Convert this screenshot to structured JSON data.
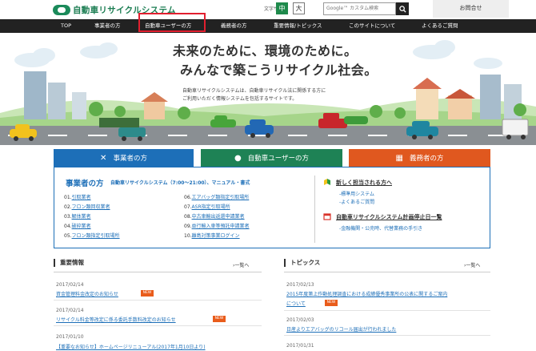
{
  "header": {
    "logo_text": "自動車リサイクルシステム",
    "font_size_label": "文字サイズ",
    "font_size_mid": "中",
    "font_size_large": "大",
    "search_placeholder": "Google™ カスタム検索",
    "inquiry": "お問合せ"
  },
  "nav": [
    "TOP",
    "事業者の方",
    "自動車ユーザーの方",
    "義務者の方",
    "重要情報/トピックス",
    "このサイトについて",
    "よくあるご質問"
  ],
  "hero": {
    "title_1": "未来のために、環境のために。",
    "title_2": "みんなで築こうリサイクル社会。",
    "desc_1": "自動車リサイクルシステムは、自動車リサイクル法に関係する方に",
    "desc_2": "ご利用いただく情報システムを包括するサイトです。"
  },
  "tabs": {
    "business": "事業者の方",
    "users": "自動車ユーザーの方",
    "obligors": "義務者の方"
  },
  "panel": {
    "heading": "事業者の方",
    "subheading": "自動車リサイクルシステム（7:00〜21:00）、マニュアル・書式",
    "links_left": [
      {
        "num": "01.",
        "label": "引取業者"
      },
      {
        "num": "02.",
        "label": "フロン類回収業者"
      },
      {
        "num": "03.",
        "label": "解体業者"
      },
      {
        "num": "04.",
        "label": "破砕業者"
      },
      {
        "num": "05.",
        "label": "フロン類指定引取場所"
      }
    ],
    "links_right": [
      {
        "num": "06.",
        "label": "エアバッグ類指定引取場所"
      },
      {
        "num": "07.",
        "label": "ASR指定引取場所"
      },
      {
        "num": "08.",
        "label": "中古車輸出返還申請業者"
      },
      {
        "num": "09.",
        "label": "並行輸入車等預託申請業者"
      },
      {
        "num": "10.",
        "label": "離島対策事業ログイン"
      }
    ],
    "new_staff_title": "新しく担当される方へ",
    "new_staff_links": [
      "-標準用システム",
      "-よくあるご質問"
    ],
    "suspension_title": "自動車リサイクルシステム計画停止日一覧",
    "suspension_links": [
      "-金融機関・公売時、代替業務の手引き"
    ]
  },
  "important": {
    "heading": "重要情報",
    "more": "一覧へ",
    "items": [
      {
        "date": "2017/02/14",
        "title": "資金管理料金改定のお知らせ",
        "new": "NEW"
      },
      {
        "date": "2017/02/14",
        "title": "リサイクル料金等改定に係る委託手数料改定のお知らせ",
        "new": "NEW"
      },
      {
        "date": "2017/01/10",
        "title": "【重要なお知らせ】ホームページリニューアル(2017年1月10日より)",
        "new": ""
      }
    ]
  },
  "topics": {
    "heading": "トピックス",
    "more": "一覧へ",
    "items": [
      {
        "date": "2017/02/13",
        "title_1": "2015年度第上作動処理調査における成績優秀事業所の公表に関するご案内",
        "title_2": "について",
        "new": "NEW"
      },
      {
        "date": "2017/02/03",
        "title_1": "日産よりエアバッグのリコール届出が行われました",
        "title_2": "",
        "new": ""
      },
      {
        "date": "2017/01/31",
        "title_1": "",
        "title_2": "",
        "new": ""
      }
    ]
  },
  "colors": {
    "business": "#1d6fb8",
    "users": "#1e8255",
    "obligors": "#e0581f",
    "nav": "#222222",
    "highlight": "#e21f2f",
    "new_badge": "#e95c1b"
  }
}
